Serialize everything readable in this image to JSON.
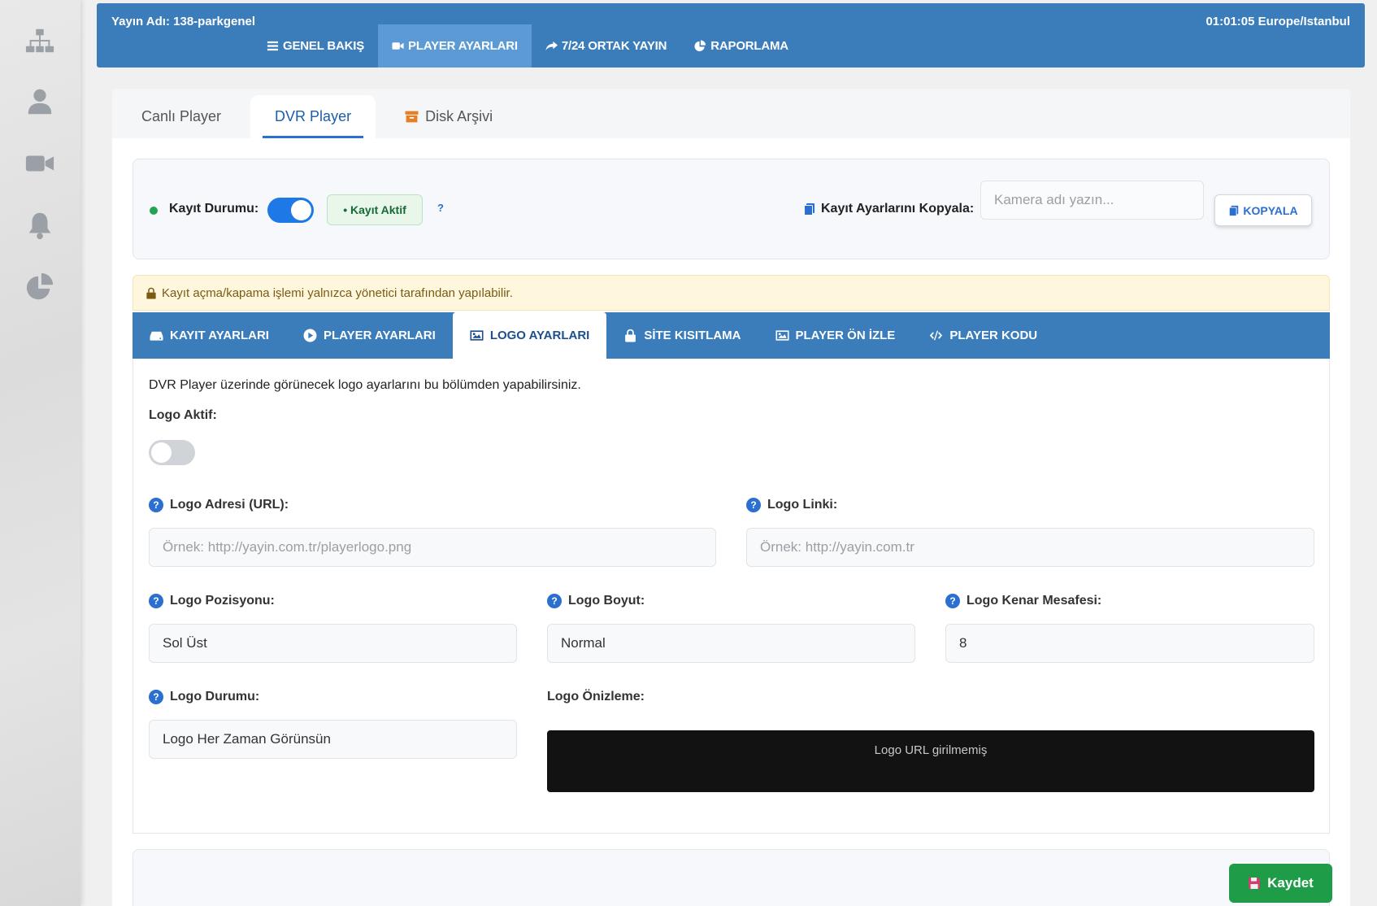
{
  "header": {
    "stream_name": "Yayın Adı: 138-parkgenel",
    "clock": "01:01:05 Europe/Istanbul",
    "nav": [
      {
        "label": "GENEL BAKIŞ",
        "icon": "list-icon"
      },
      {
        "label": "PLAYER AYARLARI",
        "icon": "video-camera-icon"
      },
      {
        "label": "7/24 ORTAK YAYIN",
        "icon": "share-icon"
      },
      {
        "label": "RAPORLAMA",
        "icon": "pie-chart-icon"
      }
    ]
  },
  "sidebar": {
    "items": [
      {
        "icon": "sitemap-icon"
      },
      {
        "icon": "user-icon"
      },
      {
        "icon": "video-camera-icon"
      },
      {
        "icon": "bell-icon"
      },
      {
        "icon": "pie-chart-icon"
      }
    ]
  },
  "player_tabs": [
    {
      "label": "Canlı Player"
    },
    {
      "label": "DVR Player"
    },
    {
      "label": "Disk Arşivi",
      "icon": "archive-icon"
    }
  ],
  "status": {
    "label": "Kayıt Durumu:",
    "badge": "• Kayıt Aktif",
    "help": "?",
    "copy_label": "Kayıt Ayarlarını Kopyala:",
    "camera_placeholder": "Kamera adı yazın...",
    "copy_button": "KOPYALA"
  },
  "warning": "Kayıt açma/kapama işlemi yalnızca yönetici tarafından yapılabilir.",
  "sub_tabs": [
    {
      "label": "KAYIT AYARLARI",
      "icon": "hdd-icon"
    },
    {
      "label": "PLAYER AYARLARI",
      "icon": "play-circle-icon"
    },
    {
      "label": "LOGO AYARLARI",
      "icon": "image-icon"
    },
    {
      "label": "SİTE KISITLAMA",
      "icon": "lock-icon"
    },
    {
      "label": "PLAYER ÖN İZLE",
      "icon": "image-icon"
    },
    {
      "label": "PLAYER KODU",
      "icon": "code-icon"
    }
  ],
  "logo": {
    "description": "DVR Player üzerinde görünecek logo ayarlarını bu bölümden yapabilirsiniz.",
    "active_label": "Logo Aktif:",
    "url_label": "Logo Adresi (URL):",
    "url_placeholder": "Örnek: http://yayin.com.tr/playerlogo.png",
    "link_label": "Logo Linki:",
    "link_placeholder": "Örnek: http://yayin.com.tr",
    "position_label": "Logo Pozisyonu:",
    "position_value": "Sol Üst",
    "size_label": "Logo Boyut:",
    "size_value": "Normal",
    "margin_label": "Logo Kenar Mesafesi:",
    "margin_value": "8",
    "status_label": "Logo Durumu:",
    "status_value": "Logo Her Zaman Görünsün",
    "preview_label": "Logo Önizleme:",
    "preview_text": "Logo URL girilmemiş"
  },
  "footer": {
    "save_button": "Kaydet"
  }
}
